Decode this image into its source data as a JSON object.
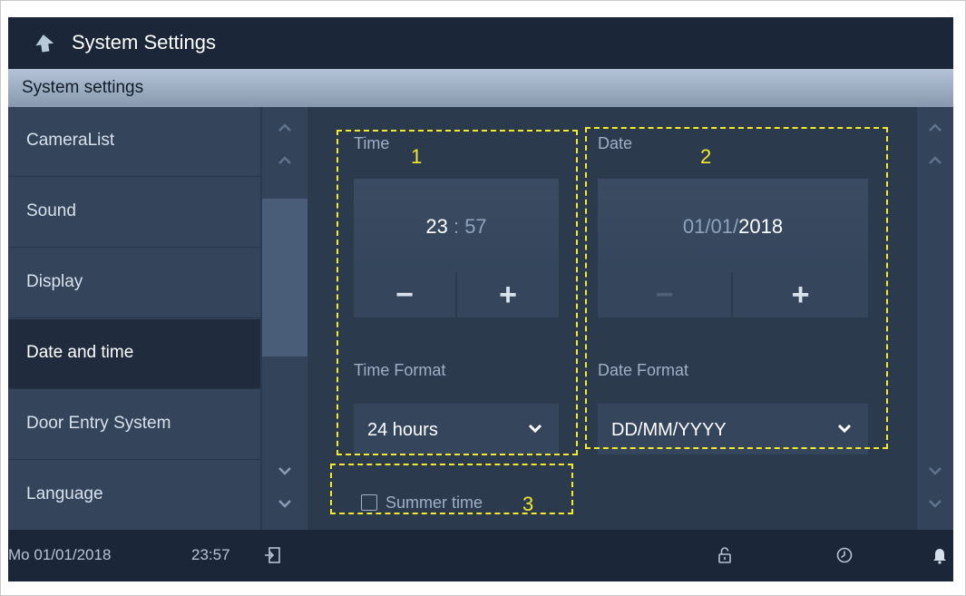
{
  "window": {
    "title": "System Settings"
  },
  "subheader": {
    "title": "System settings"
  },
  "sidebar": {
    "items": [
      {
        "label": "CameraList"
      },
      {
        "label": "Sound"
      },
      {
        "label": "Display"
      },
      {
        "label": "Date and time",
        "active": true
      },
      {
        "label": "Door Entry System"
      },
      {
        "label": "Language"
      }
    ]
  },
  "time": {
    "label": "Time",
    "hours": "23",
    "separator": ":",
    "minutes": "57",
    "minus": "−",
    "plus": "+",
    "format_label": "Time Format",
    "format_value": "24 hours"
  },
  "date": {
    "label": "Date",
    "day": "01",
    "sep1": "/",
    "month": "01",
    "sep2": "/",
    "year": "2018",
    "minus": "−",
    "plus": "+",
    "format_label": "Date Format",
    "format_value": "DD/MM/YYYY"
  },
  "summer_time": {
    "label": "Summer time",
    "checked": false
  },
  "markers": {
    "one": "1",
    "two": "2",
    "three": "3"
  },
  "status": {
    "date": "Mo 01/01/2018",
    "time": "23:57"
  },
  "icons": [
    "back-arrow-icon",
    "chevron-up-icon",
    "chevron-down-icon",
    "logout-icon",
    "lock-icon",
    "clock-icon",
    "bell-icon"
  ],
  "colors": {
    "accent": "#f2ea2a",
    "title_bar": "#1b2638",
    "panel": "#2c3a4e"
  }
}
